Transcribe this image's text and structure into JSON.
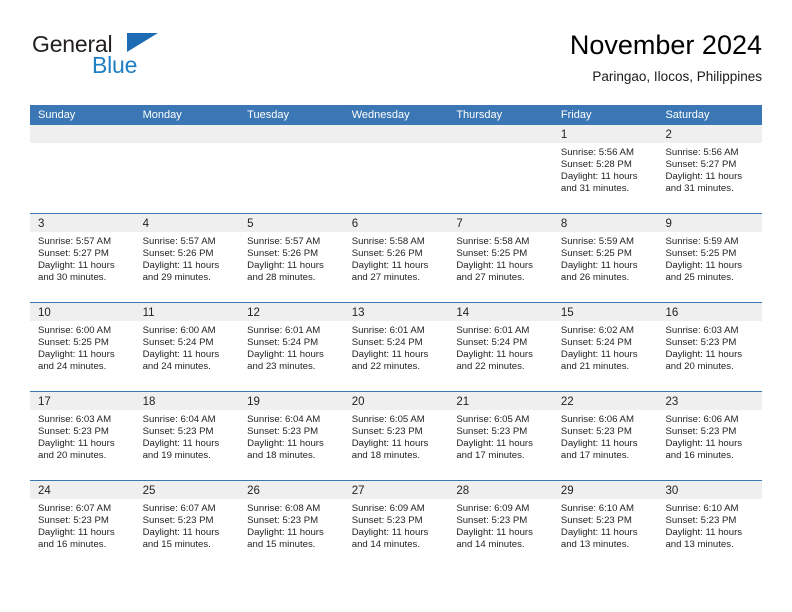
{
  "brand": {
    "name_part1": "General",
    "name_part2": "Blue",
    "triangle_icon": "brand-triangle-icon",
    "color_dark": "#231f20",
    "color_blue": "#1f7fc4"
  },
  "header": {
    "title": "November 2024",
    "subtitle": "Paringao, Ilocos, Philippines"
  },
  "theme": {
    "header_blue": "#3b77b5",
    "day_band_gray": "#efefef",
    "text": "#231f20"
  },
  "calendar": {
    "weekdays": [
      "Sunday",
      "Monday",
      "Tuesday",
      "Wednesday",
      "Thursday",
      "Friday",
      "Saturday"
    ],
    "weeks": [
      [
        {
          "day": "",
          "sunrise": "",
          "sunset": "",
          "daylight_line1": "",
          "daylight_line2": "",
          "empty": true
        },
        {
          "day": "",
          "sunrise": "",
          "sunset": "",
          "daylight_line1": "",
          "daylight_line2": "",
          "empty": true
        },
        {
          "day": "",
          "sunrise": "",
          "sunset": "",
          "daylight_line1": "",
          "daylight_line2": "",
          "empty": true
        },
        {
          "day": "",
          "sunrise": "",
          "sunset": "",
          "daylight_line1": "",
          "daylight_line2": "",
          "empty": true
        },
        {
          "day": "",
          "sunrise": "",
          "sunset": "",
          "daylight_line1": "",
          "daylight_line2": "",
          "empty": true
        },
        {
          "day": "1",
          "sunrise": "Sunrise: 5:56 AM",
          "sunset": "Sunset: 5:28 PM",
          "daylight_line1": "Daylight: 11 hours",
          "daylight_line2": "and 31 minutes."
        },
        {
          "day": "2",
          "sunrise": "Sunrise: 5:56 AM",
          "sunset": "Sunset: 5:27 PM",
          "daylight_line1": "Daylight: 11 hours",
          "daylight_line2": "and 31 minutes."
        }
      ],
      [
        {
          "day": "3",
          "sunrise": "Sunrise: 5:57 AM",
          "sunset": "Sunset: 5:27 PM",
          "daylight_line1": "Daylight: 11 hours",
          "daylight_line2": "and 30 minutes."
        },
        {
          "day": "4",
          "sunrise": "Sunrise: 5:57 AM",
          "sunset": "Sunset: 5:26 PM",
          "daylight_line1": "Daylight: 11 hours",
          "daylight_line2": "and 29 minutes."
        },
        {
          "day": "5",
          "sunrise": "Sunrise: 5:57 AM",
          "sunset": "Sunset: 5:26 PM",
          "daylight_line1": "Daylight: 11 hours",
          "daylight_line2": "and 28 minutes."
        },
        {
          "day": "6",
          "sunrise": "Sunrise: 5:58 AM",
          "sunset": "Sunset: 5:26 PM",
          "daylight_line1": "Daylight: 11 hours",
          "daylight_line2": "and 27 minutes."
        },
        {
          "day": "7",
          "sunrise": "Sunrise: 5:58 AM",
          "sunset": "Sunset: 5:25 PM",
          "daylight_line1": "Daylight: 11 hours",
          "daylight_line2": "and 27 minutes."
        },
        {
          "day": "8",
          "sunrise": "Sunrise: 5:59 AM",
          "sunset": "Sunset: 5:25 PM",
          "daylight_line1": "Daylight: 11 hours",
          "daylight_line2": "and 26 minutes."
        },
        {
          "day": "9",
          "sunrise": "Sunrise: 5:59 AM",
          "sunset": "Sunset: 5:25 PM",
          "daylight_line1": "Daylight: 11 hours",
          "daylight_line2": "and 25 minutes."
        }
      ],
      [
        {
          "day": "10",
          "sunrise": "Sunrise: 6:00 AM",
          "sunset": "Sunset: 5:25 PM",
          "daylight_line1": "Daylight: 11 hours",
          "daylight_line2": "and 24 minutes."
        },
        {
          "day": "11",
          "sunrise": "Sunrise: 6:00 AM",
          "sunset": "Sunset: 5:24 PM",
          "daylight_line1": "Daylight: 11 hours",
          "daylight_line2": "and 24 minutes."
        },
        {
          "day": "12",
          "sunrise": "Sunrise: 6:01 AM",
          "sunset": "Sunset: 5:24 PM",
          "daylight_line1": "Daylight: 11 hours",
          "daylight_line2": "and 23 minutes."
        },
        {
          "day": "13",
          "sunrise": "Sunrise: 6:01 AM",
          "sunset": "Sunset: 5:24 PM",
          "daylight_line1": "Daylight: 11 hours",
          "daylight_line2": "and 22 minutes."
        },
        {
          "day": "14",
          "sunrise": "Sunrise: 6:01 AM",
          "sunset": "Sunset: 5:24 PM",
          "daylight_line1": "Daylight: 11 hours",
          "daylight_line2": "and 22 minutes."
        },
        {
          "day": "15",
          "sunrise": "Sunrise: 6:02 AM",
          "sunset": "Sunset: 5:24 PM",
          "daylight_line1": "Daylight: 11 hours",
          "daylight_line2": "and 21 minutes."
        },
        {
          "day": "16",
          "sunrise": "Sunrise: 6:03 AM",
          "sunset": "Sunset: 5:23 PM",
          "daylight_line1": "Daylight: 11 hours",
          "daylight_line2": "and 20 minutes."
        }
      ],
      [
        {
          "day": "17",
          "sunrise": "Sunrise: 6:03 AM",
          "sunset": "Sunset: 5:23 PM",
          "daylight_line1": "Daylight: 11 hours",
          "daylight_line2": "and 20 minutes."
        },
        {
          "day": "18",
          "sunrise": "Sunrise: 6:04 AM",
          "sunset": "Sunset: 5:23 PM",
          "daylight_line1": "Daylight: 11 hours",
          "daylight_line2": "and 19 minutes."
        },
        {
          "day": "19",
          "sunrise": "Sunrise: 6:04 AM",
          "sunset": "Sunset: 5:23 PM",
          "daylight_line1": "Daylight: 11 hours",
          "daylight_line2": "and 18 minutes."
        },
        {
          "day": "20",
          "sunrise": "Sunrise: 6:05 AM",
          "sunset": "Sunset: 5:23 PM",
          "daylight_line1": "Daylight: 11 hours",
          "daylight_line2": "and 18 minutes."
        },
        {
          "day": "21",
          "sunrise": "Sunrise: 6:05 AM",
          "sunset": "Sunset: 5:23 PM",
          "daylight_line1": "Daylight: 11 hours",
          "daylight_line2": "and 17 minutes."
        },
        {
          "day": "22",
          "sunrise": "Sunrise: 6:06 AM",
          "sunset": "Sunset: 5:23 PM",
          "daylight_line1": "Daylight: 11 hours",
          "daylight_line2": "and 17 minutes."
        },
        {
          "day": "23",
          "sunrise": "Sunrise: 6:06 AM",
          "sunset": "Sunset: 5:23 PM",
          "daylight_line1": "Daylight: 11 hours",
          "daylight_line2": "and 16 minutes."
        }
      ],
      [
        {
          "day": "24",
          "sunrise": "Sunrise: 6:07 AM",
          "sunset": "Sunset: 5:23 PM",
          "daylight_line1": "Daylight: 11 hours",
          "daylight_line2": "and 16 minutes."
        },
        {
          "day": "25",
          "sunrise": "Sunrise: 6:07 AM",
          "sunset": "Sunset: 5:23 PM",
          "daylight_line1": "Daylight: 11 hours",
          "daylight_line2": "and 15 minutes."
        },
        {
          "day": "26",
          "sunrise": "Sunrise: 6:08 AM",
          "sunset": "Sunset: 5:23 PM",
          "daylight_line1": "Daylight: 11 hours",
          "daylight_line2": "and 15 minutes."
        },
        {
          "day": "27",
          "sunrise": "Sunrise: 6:09 AM",
          "sunset": "Sunset: 5:23 PM",
          "daylight_line1": "Daylight: 11 hours",
          "daylight_line2": "and 14 minutes."
        },
        {
          "day": "28",
          "sunrise": "Sunrise: 6:09 AM",
          "sunset": "Sunset: 5:23 PM",
          "daylight_line1": "Daylight: 11 hours",
          "daylight_line2": "and 14 minutes."
        },
        {
          "day": "29",
          "sunrise": "Sunrise: 6:10 AM",
          "sunset": "Sunset: 5:23 PM",
          "daylight_line1": "Daylight: 11 hours",
          "daylight_line2": "and 13 minutes."
        },
        {
          "day": "30",
          "sunrise": "Sunrise: 6:10 AM",
          "sunset": "Sunset: 5:23 PM",
          "daylight_line1": "Daylight: 11 hours",
          "daylight_line2": "and 13 minutes."
        }
      ]
    ]
  }
}
